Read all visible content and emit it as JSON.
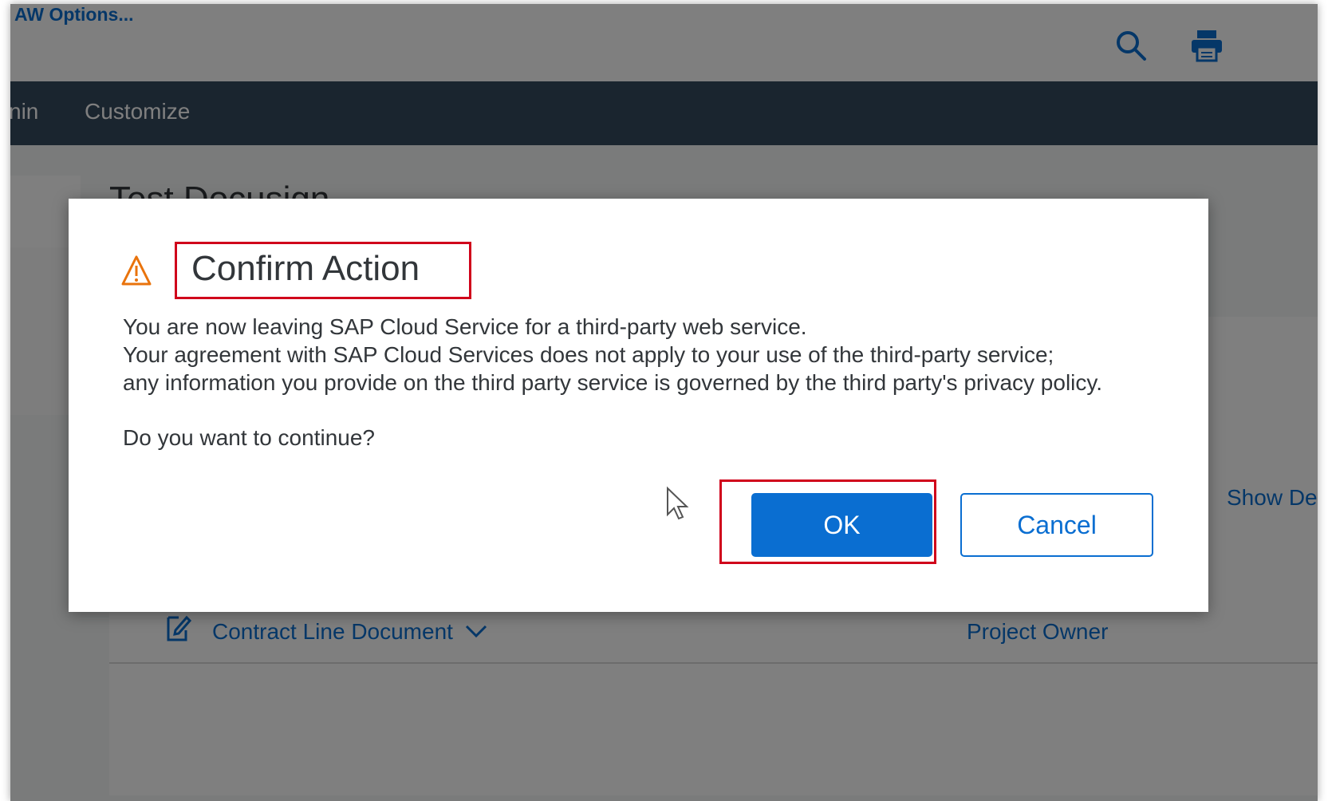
{
  "header": {
    "options_link": "AW Options...",
    "icons": [
      "search-icon",
      "print-icon"
    ]
  },
  "nav": {
    "items": [
      {
        "label": "nin"
      },
      {
        "label": "Customize"
      }
    ]
  },
  "page": {
    "title": "Test  Docusign",
    "show_details_link": "Show De"
  },
  "table": {
    "rows": [
      {
        "icon": "document-edit-icon",
        "document": "Contract Line Document",
        "owner": "Project Owner"
      }
    ]
  },
  "dialog": {
    "icon": "warning-icon",
    "title": "Confirm Action",
    "message_lines": [
      "You are now leaving SAP Cloud Service for a third-party web service.",
      "Your agreement with SAP Cloud Services does not apply to your use of the third-party service;",
      "any information you provide on the third party service is governed by the third party's privacy policy."
    ],
    "question": "Do you want to continue?",
    "ok_label": "OK",
    "cancel_label": "Cancel"
  },
  "colors": {
    "accent": "#0a6ed1",
    "shellbar": "#354a5f",
    "highlight_box": "#d0021b",
    "warning": "#e9730c"
  }
}
